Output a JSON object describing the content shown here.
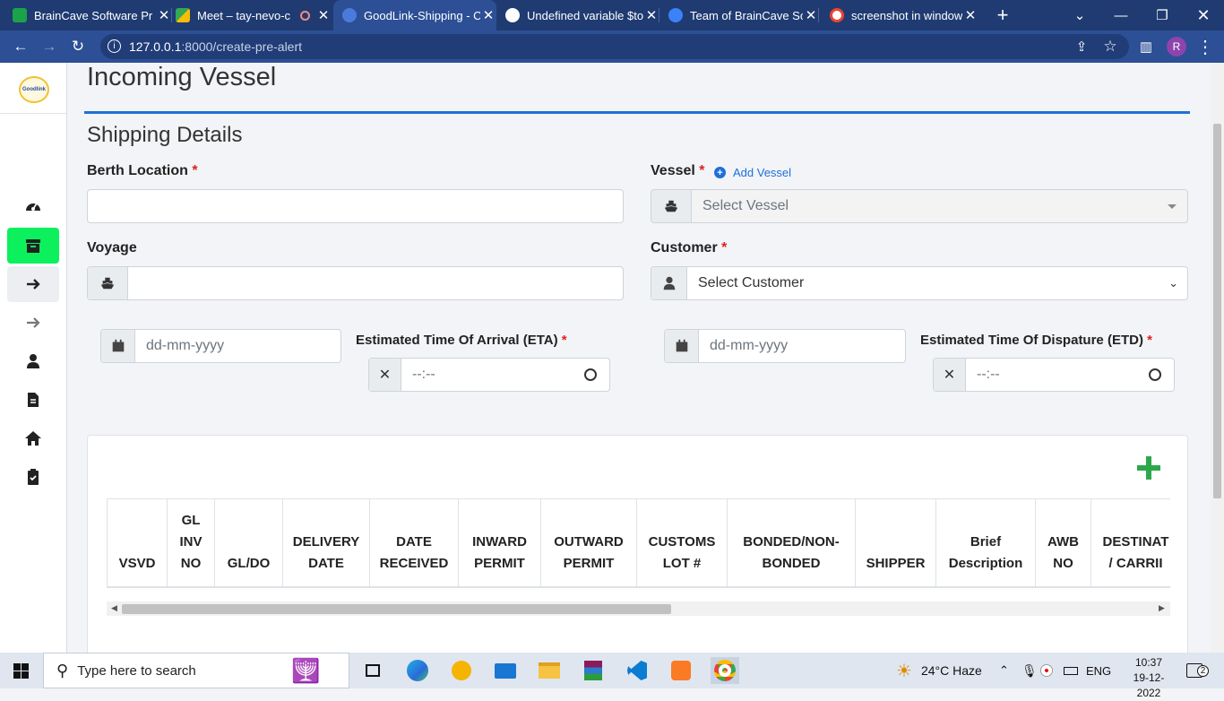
{
  "browser": {
    "tabs": [
      {
        "title": "BrainCave Software Pr",
        "color": "#1aa34a"
      },
      {
        "title": "Meet – tay-nevo-c",
        "color": "#34a853"
      },
      {
        "title": "GoodLink-Shipping - C",
        "color": "#4a7bdc"
      },
      {
        "title": "Undefined variable $to",
        "color": "#ffffff"
      },
      {
        "title": "Team of BrainCave Sof",
        "color": "#3b82f6"
      },
      {
        "title": "screenshot in window",
        "color": "#ffffff"
      }
    ],
    "new_tab": "+",
    "url_host": "127.0.0.1",
    "url_path": ":8000/create-pre-alert",
    "profile_initial": "R"
  },
  "sidebar": {
    "logo_text": "Goodlink",
    "items": [
      {
        "icon": "dashboard-icon"
      },
      {
        "icon": "archive-icon",
        "active": true
      },
      {
        "icon": "arrow-right-icon",
        "selected": true
      },
      {
        "icon": "arrow-right-light-icon"
      },
      {
        "icon": "user-icon"
      },
      {
        "icon": "file-icon"
      },
      {
        "icon": "home-icon"
      },
      {
        "icon": "clipboard-check-icon"
      }
    ]
  },
  "page": {
    "title": "Incoming Vessel",
    "section": "Shipping Details",
    "berth_label": "Berth Location",
    "vessel_label": "Vessel",
    "add_vessel": "Add Vessel",
    "vessel_placeholder": "Select Vessel",
    "voyage_label": "Voyage",
    "customer_label": "Customer",
    "customer_placeholder": "Select Customer",
    "date_placeholder": "dd-mm-yyyy",
    "time_placeholder": "--:--",
    "eta_label": "Estimated Time Of Arrival (ETA)",
    "etd_label": "Estimated Time Of Dispature (ETD)",
    "required": "*"
  },
  "table": {
    "columns": [
      [
        "VSVD"
      ],
      [
        "GL",
        "INV",
        "NO"
      ],
      [
        "GL/DO"
      ],
      [
        "DELIVERY",
        "DATE"
      ],
      [
        "DATE",
        "RECEIVED"
      ],
      [
        "INWARD",
        "PERMIT"
      ],
      [
        "OUTWARD",
        "PERMIT"
      ],
      [
        "CUSTOMS",
        "LOT #"
      ],
      [
        "BONDED/NON-",
        "BONDED"
      ],
      [
        "SHIPPER"
      ],
      [
        "Brief",
        "Description"
      ],
      [
        "AWB",
        "NO"
      ],
      [
        "DESTINAT",
        "/ CARRII"
      ]
    ]
  },
  "taskbar": {
    "search_placeholder": "Type here to search",
    "weather": "24°C  Haze",
    "lang": "ENG",
    "time": "10:37",
    "date": "19-12-2022",
    "notif_count": "2"
  }
}
